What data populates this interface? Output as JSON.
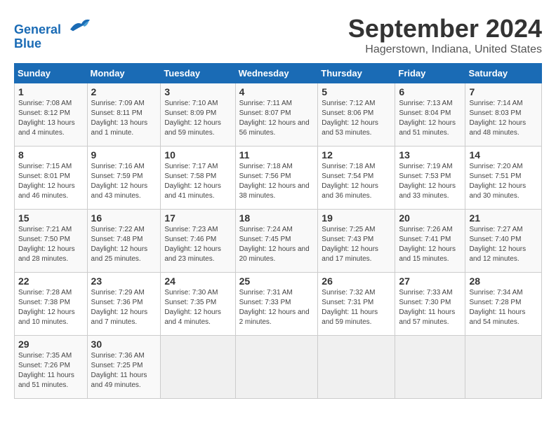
{
  "logo": {
    "line1": "General",
    "line2": "Blue"
  },
  "title": "September 2024",
  "location": "Hagerstown, Indiana, United States",
  "days_of_week": [
    "Sunday",
    "Monday",
    "Tuesday",
    "Wednesday",
    "Thursday",
    "Friday",
    "Saturday"
  ],
  "weeks": [
    [
      {
        "day": "1",
        "sunrise": "7:08 AM",
        "sunset": "8:12 PM",
        "daylight": "13 hours and 4 minutes."
      },
      {
        "day": "2",
        "sunrise": "7:09 AM",
        "sunset": "8:11 PM",
        "daylight": "13 hours and 1 minute."
      },
      {
        "day": "3",
        "sunrise": "7:10 AM",
        "sunset": "8:09 PM",
        "daylight": "12 hours and 59 minutes."
      },
      {
        "day": "4",
        "sunrise": "7:11 AM",
        "sunset": "8:07 PM",
        "daylight": "12 hours and 56 minutes."
      },
      {
        "day": "5",
        "sunrise": "7:12 AM",
        "sunset": "8:06 PM",
        "daylight": "12 hours and 53 minutes."
      },
      {
        "day": "6",
        "sunrise": "7:13 AM",
        "sunset": "8:04 PM",
        "daylight": "12 hours and 51 minutes."
      },
      {
        "day": "7",
        "sunrise": "7:14 AM",
        "sunset": "8:03 PM",
        "daylight": "12 hours and 48 minutes."
      }
    ],
    [
      {
        "day": "8",
        "sunrise": "7:15 AM",
        "sunset": "8:01 PM",
        "daylight": "12 hours and 46 minutes."
      },
      {
        "day": "9",
        "sunrise": "7:16 AM",
        "sunset": "7:59 PM",
        "daylight": "12 hours and 43 minutes."
      },
      {
        "day": "10",
        "sunrise": "7:17 AM",
        "sunset": "7:58 PM",
        "daylight": "12 hours and 41 minutes."
      },
      {
        "day": "11",
        "sunrise": "7:18 AM",
        "sunset": "7:56 PM",
        "daylight": "12 hours and 38 minutes."
      },
      {
        "day": "12",
        "sunrise": "7:18 AM",
        "sunset": "7:54 PM",
        "daylight": "12 hours and 36 minutes."
      },
      {
        "day": "13",
        "sunrise": "7:19 AM",
        "sunset": "7:53 PM",
        "daylight": "12 hours and 33 minutes."
      },
      {
        "day": "14",
        "sunrise": "7:20 AM",
        "sunset": "7:51 PM",
        "daylight": "12 hours and 30 minutes."
      }
    ],
    [
      {
        "day": "15",
        "sunrise": "7:21 AM",
        "sunset": "7:50 PM",
        "daylight": "12 hours and 28 minutes."
      },
      {
        "day": "16",
        "sunrise": "7:22 AM",
        "sunset": "7:48 PM",
        "daylight": "12 hours and 25 minutes."
      },
      {
        "day": "17",
        "sunrise": "7:23 AM",
        "sunset": "7:46 PM",
        "daylight": "12 hours and 23 minutes."
      },
      {
        "day": "18",
        "sunrise": "7:24 AM",
        "sunset": "7:45 PM",
        "daylight": "12 hours and 20 minutes."
      },
      {
        "day": "19",
        "sunrise": "7:25 AM",
        "sunset": "7:43 PM",
        "daylight": "12 hours and 17 minutes."
      },
      {
        "day": "20",
        "sunrise": "7:26 AM",
        "sunset": "7:41 PM",
        "daylight": "12 hours and 15 minutes."
      },
      {
        "day": "21",
        "sunrise": "7:27 AM",
        "sunset": "7:40 PM",
        "daylight": "12 hours and 12 minutes."
      }
    ],
    [
      {
        "day": "22",
        "sunrise": "7:28 AM",
        "sunset": "7:38 PM",
        "daylight": "12 hours and 10 minutes."
      },
      {
        "day": "23",
        "sunrise": "7:29 AM",
        "sunset": "7:36 PM",
        "daylight": "12 hours and 7 minutes."
      },
      {
        "day": "24",
        "sunrise": "7:30 AM",
        "sunset": "7:35 PM",
        "daylight": "12 hours and 4 minutes."
      },
      {
        "day": "25",
        "sunrise": "7:31 AM",
        "sunset": "7:33 PM",
        "daylight": "12 hours and 2 minutes."
      },
      {
        "day": "26",
        "sunrise": "7:32 AM",
        "sunset": "7:31 PM",
        "daylight": "11 hours and 59 minutes."
      },
      {
        "day": "27",
        "sunrise": "7:33 AM",
        "sunset": "7:30 PM",
        "daylight": "11 hours and 57 minutes."
      },
      {
        "day": "28",
        "sunrise": "7:34 AM",
        "sunset": "7:28 PM",
        "daylight": "11 hours and 54 minutes."
      }
    ],
    [
      {
        "day": "29",
        "sunrise": "7:35 AM",
        "sunset": "7:26 PM",
        "daylight": "11 hours and 51 minutes."
      },
      {
        "day": "30",
        "sunrise": "7:36 AM",
        "sunset": "7:25 PM",
        "daylight": "11 hours and 49 minutes."
      },
      null,
      null,
      null,
      null,
      null
    ]
  ],
  "labels": {
    "sunrise": "Sunrise:",
    "sunset": "Sunset:",
    "daylight": "Daylight:"
  }
}
